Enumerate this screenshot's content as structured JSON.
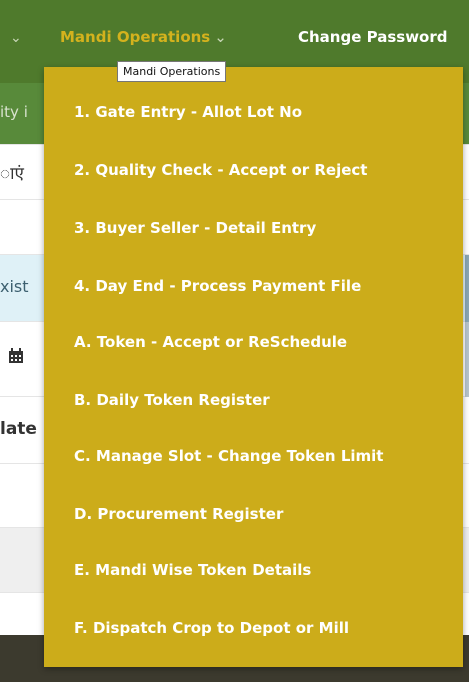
{
  "navbar": {
    "mandi_operations": "Mandi Operations",
    "change_password": "Change Password"
  },
  "tooltip": "Mandi Operations",
  "background": {
    "row1": "ity i",
    "row2": "ाएं",
    "row4": "xist",
    "row5_icon": "calendar-icon",
    "row6": "late"
  },
  "menu": [
    "1. Gate Entry - Allot Lot No",
    "2. Quality Check - Accept or Reject",
    "3. Buyer Seller - Detail Entry",
    "4. Day End - Process Payment File",
    "A. Token - Accept or ReSchedule",
    "B. Daily Token Register",
    "C. Manage Slot - Change Token Limit",
    "D. Procurement Register",
    "E. Mandi Wise Token Details",
    "F. Dispatch Crop to Depot or Mill"
  ],
  "colors": {
    "navbar": "#4f7a2c",
    "dropdown": "#ccac1a",
    "active_nav": "#d4b21d"
  }
}
